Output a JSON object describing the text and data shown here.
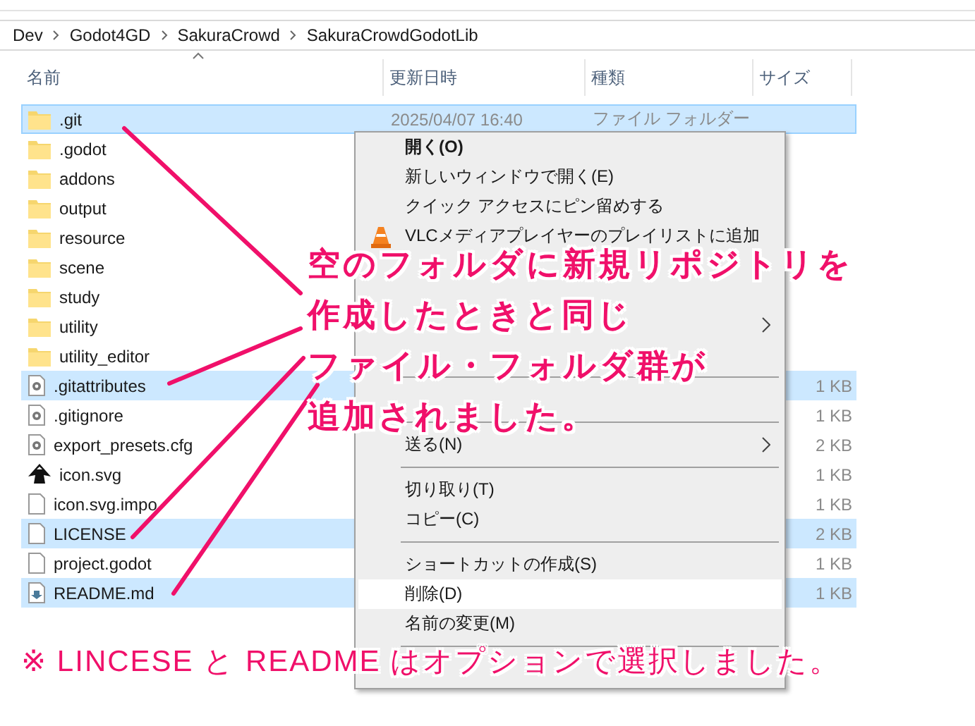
{
  "breadcrumb": [
    "Dev",
    "Godot4GD",
    "SakuraCrowd",
    "SakuraCrowdGodotLib"
  ],
  "columns": [
    "名前",
    "更新日時",
    "種類",
    "サイズ"
  ],
  "files": [
    {
      "name": ".git",
      "kind": "folder",
      "selected": true,
      "focused": true,
      "modified": "2025/04/07 16:40",
      "type": "ファイル フォルダー"
    },
    {
      "name": ".godot",
      "kind": "folder",
      "selected": false
    },
    {
      "name": "addons",
      "kind": "folder",
      "selected": false
    },
    {
      "name": "output",
      "kind": "folder",
      "selected": false
    },
    {
      "name": "resource",
      "kind": "folder",
      "selected": false
    },
    {
      "name": "scene",
      "kind": "folder",
      "selected": false
    },
    {
      "name": "study",
      "kind": "folder",
      "selected": false
    },
    {
      "name": "utility",
      "kind": "folder",
      "selected": false
    },
    {
      "name": "utility_editor",
      "kind": "folder",
      "selected": false
    },
    {
      "name": ".gitattributes",
      "kind": "config",
      "selected": true,
      "size": "1 KB"
    },
    {
      "name": ".gitignore",
      "kind": "config",
      "selected": false,
      "size": "1 KB"
    },
    {
      "name": "export_presets.cfg",
      "kind": "config",
      "selected": false,
      "size": "2 KB"
    },
    {
      "name": "icon.svg",
      "kind": "vector",
      "selected": false,
      "size": "1 KB"
    },
    {
      "name": "icon.svg.impo",
      "kind": "blank",
      "selected": false,
      "size": "1 KB"
    },
    {
      "name": "LICENSE",
      "kind": "blank",
      "selected": true,
      "size": "2 KB"
    },
    {
      "name": "project.godot",
      "kind": "blank",
      "selected": false,
      "size": "1 KB"
    },
    {
      "name": "README.md",
      "kind": "markdown",
      "selected": true,
      "size": "1 KB"
    }
  ],
  "context_menu": [
    {
      "kind": "item",
      "label": "開く(O)",
      "bold": true,
      "highlighted": false
    },
    {
      "kind": "item",
      "label": "新しいウィンドウで開く(E)",
      "highlighted": false
    },
    {
      "kind": "item",
      "label": "クイック アクセスにピン留めする",
      "highlighted": false
    },
    {
      "kind": "item",
      "label": "VLCメディアプレイヤーのプレイリストに追加",
      "highlighted": false
    },
    {
      "kind": "covered"
    },
    {
      "kind": "covered"
    },
    {
      "kind": "covered",
      "submenu": true
    },
    {
      "kind": "covered"
    },
    {
      "kind": "separator"
    },
    {
      "kind": "covered"
    },
    {
      "kind": "separator"
    },
    {
      "kind": "item",
      "label": "送る(N)",
      "submenu": true,
      "highlighted": false
    },
    {
      "kind": "separator"
    },
    {
      "kind": "item",
      "label": "切り取り(T)",
      "highlighted": false
    },
    {
      "kind": "item",
      "label": "コピー(C)",
      "highlighted": false
    },
    {
      "kind": "separator"
    },
    {
      "kind": "item",
      "label": "ショートカットの作成(S)",
      "highlighted": false
    },
    {
      "kind": "item",
      "label": "削除(D)",
      "highlighted": true
    },
    {
      "kind": "item",
      "label": "名前の変更(M)",
      "highlighted": false
    },
    {
      "kind": "separator"
    },
    {
      "kind": "covered"
    }
  ],
  "annotation": [
    "空のフォルダに新規リポジトリを",
    "作成したときと同じ",
    "ファイル・フォルダ群が",
    "追加されました。"
  ],
  "note": "※ LINCESE と README はオプションで選択しました。"
}
